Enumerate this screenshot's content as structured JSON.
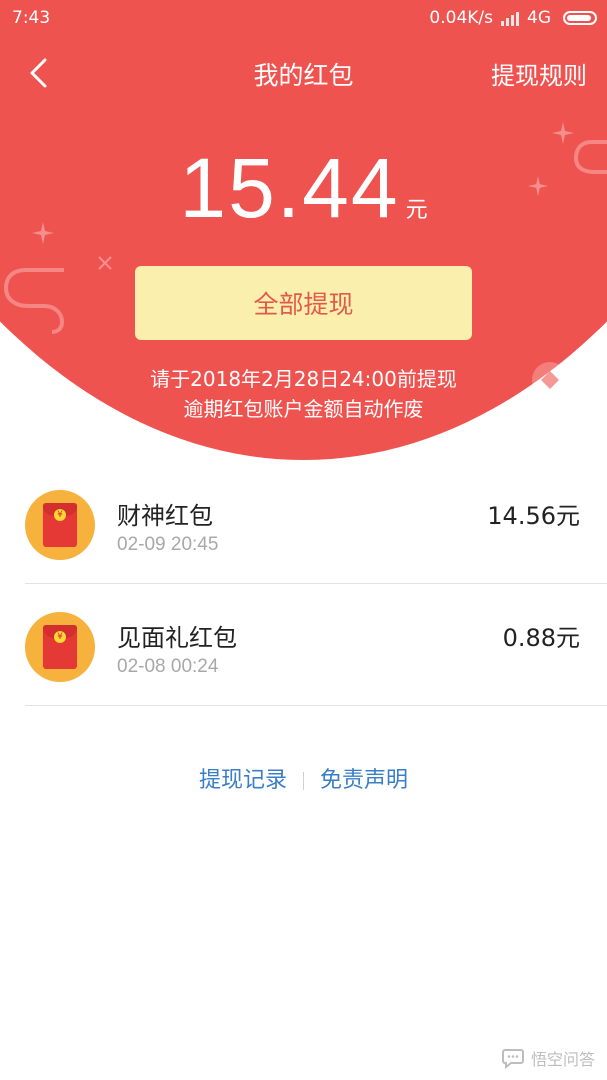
{
  "status_bar": {
    "time": "7:43",
    "network_speed": "0.04K/s",
    "network_type": "4G",
    "icons": [
      "signal-icon",
      "battery-icon"
    ]
  },
  "header": {
    "back_icon": "chevron-left-icon",
    "title": "我的红包",
    "rules_link": "提现规则"
  },
  "balance": {
    "amount": "15.44",
    "unit": "元"
  },
  "withdraw_all_button": "全部提现",
  "notice": {
    "line1": "请于2018年2月28日24:00前提现",
    "line2": "逾期红包账户金额自动作废"
  },
  "records": [
    {
      "icon": "red-envelope-icon",
      "name": "财神红包",
      "time": "02-09 20:45",
      "amount": "14.56元"
    },
    {
      "icon": "red-envelope-icon",
      "name": "见面礼红包",
      "time": "02-08 00:24",
      "amount": "0.88元"
    }
  ],
  "footer": {
    "withdraw_history": "提现记录",
    "disclaimer": "免责声明"
  },
  "watermark": {
    "text": "悟空问答"
  },
  "colors": {
    "primary_red": "#ef5350",
    "button_yellow": "#fbefae",
    "link_blue": "#3a7ec8",
    "icon_orange": "#f6b23d"
  }
}
